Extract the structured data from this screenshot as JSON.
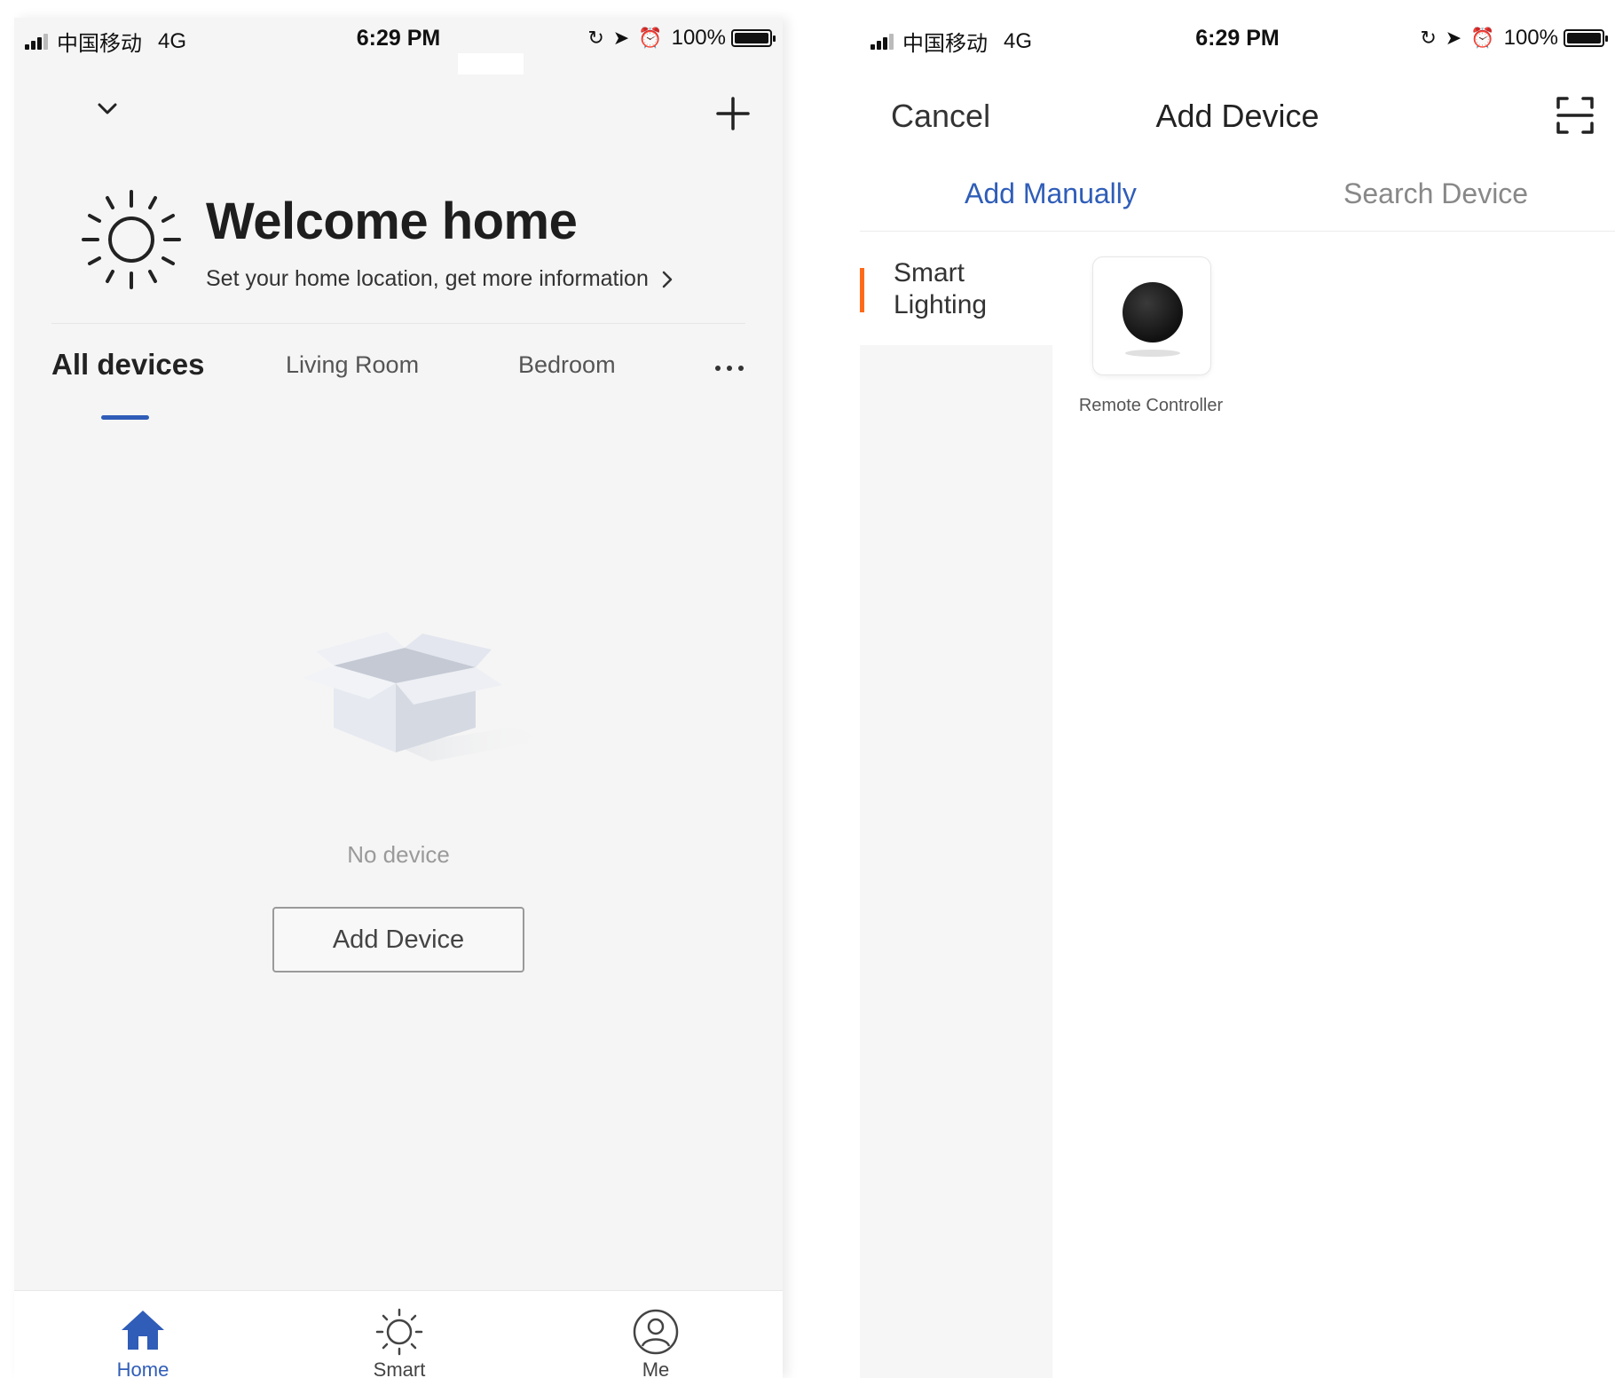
{
  "status_bar": {
    "carrier": "中国移动",
    "network": "4G",
    "time": "6:29 PM",
    "battery": "100%",
    "battery_level": 1.0
  },
  "home_screen": {
    "welcome_title": "Welcome home",
    "welcome_subtitle": "Set your home location, get more information",
    "tabs": [
      {
        "label": "All devices",
        "active": true
      },
      {
        "label": "Living Room",
        "active": false
      },
      {
        "label": "Bedroom",
        "active": false
      }
    ],
    "empty_message": "No device",
    "add_device_label": "Add Device",
    "bottom_tabs": [
      {
        "label": "Home",
        "icon": "home-icon",
        "active": true
      },
      {
        "label": "Smart",
        "icon": "sun-icon",
        "active": false
      },
      {
        "label": "Me",
        "icon": "user-icon",
        "active": false
      }
    ],
    "accent_color": "#2f5db8"
  },
  "add_device_screen": {
    "cancel_label": "Cancel",
    "title": "Add Device",
    "tabs": [
      {
        "label": "Add Manually",
        "active": true
      },
      {
        "label": "Search Device",
        "active": false
      }
    ],
    "categories": [
      {
        "label": "Smart Lighting",
        "active": true
      }
    ],
    "devices": [
      {
        "label": "Remote Controller",
        "icon": "remote-controller-icon"
      }
    ],
    "category_marker_color": "#ff6a1a",
    "accent_color": "#2f5db8"
  }
}
